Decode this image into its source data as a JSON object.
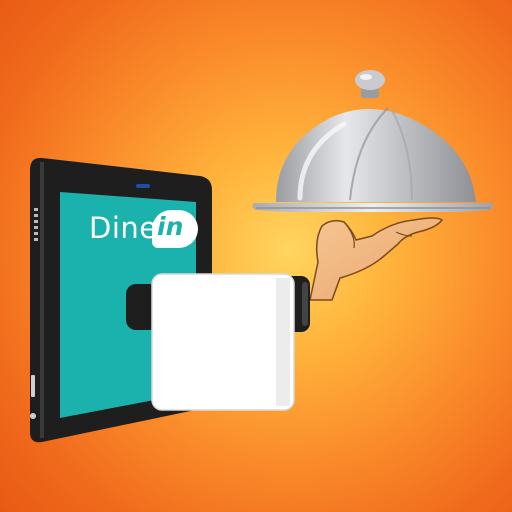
{
  "logo": {
    "word": "Dine",
    "badge_word": "in"
  },
  "colors": {
    "background_center": "#ffd560",
    "background_edge": "#e85a14",
    "screen_teal": "#1bb1ac",
    "tablet_frame": "#1e1e1e",
    "cloche_silver": "#c9cbcf",
    "sleeve_white": "#ffffff",
    "hand_skin": "#f2b981"
  },
  "icons": [
    "tablet-icon",
    "cloche-icon",
    "hand-icon",
    "sleeve-icon"
  ]
}
